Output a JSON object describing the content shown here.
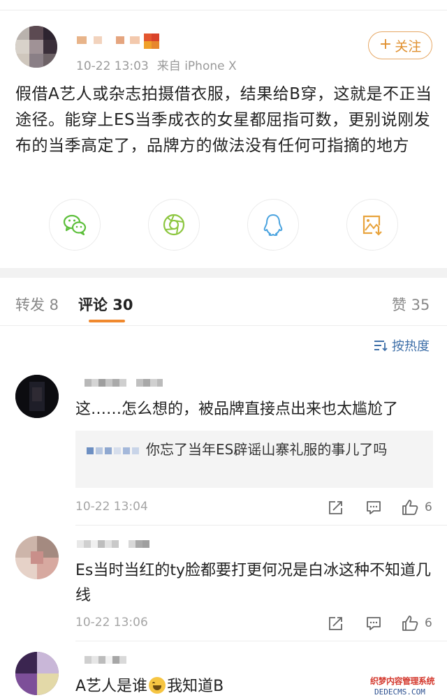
{
  "post": {
    "meta_time": "10-22 13:03",
    "meta_source": "来自 iPhone X",
    "follow_label": "关注",
    "text": "假借A艺人或杂志拍摄借衣服，结果给B穿，这就是不正当途径。能穿上ES当季成衣的女星都屈指可数，更别说刚发布的当季高定了，品牌方的做法没有任何可指摘的地方",
    "share_icons": [
      "wechat-icon",
      "moments-icon",
      "qq-icon",
      "save-image-icon"
    ]
  },
  "tabs": {
    "repost": "转发 8",
    "comments": "评论 30",
    "likes": "赞 35",
    "active": "comments"
  },
  "sort_label": "按热度",
  "comments": [
    {
      "text": "这……怎么想的，被品牌直接点出来也太尴尬了",
      "reply_text": "你忘了当年ES辟谣山寨礼服的事儿了吗",
      "time": "10-22 13:04",
      "like_count": "6"
    },
    {
      "text": "Es当时当红的ty脸都要打更何况是白冰这种不知道几线",
      "time": "10-22 13:06",
      "like_count": "6"
    },
    {
      "text_before": "A艺人是谁",
      "emoji": "laughing-emoji",
      "text_after": "我知道B"
    }
  ],
  "watermark": {
    "line1": "织梦内容管理系统",
    "line2": "DEDECMS.COM"
  },
  "colors": {
    "accent_orange": "#f0892e",
    "follow_orange": "#e0902f",
    "link_blue": "#3e6fa8",
    "wechat_green": "#5cbf3a",
    "moments_green": "#8cc63f",
    "qq_blue": "#4aa3df",
    "save_orange": "#e8a33c"
  }
}
